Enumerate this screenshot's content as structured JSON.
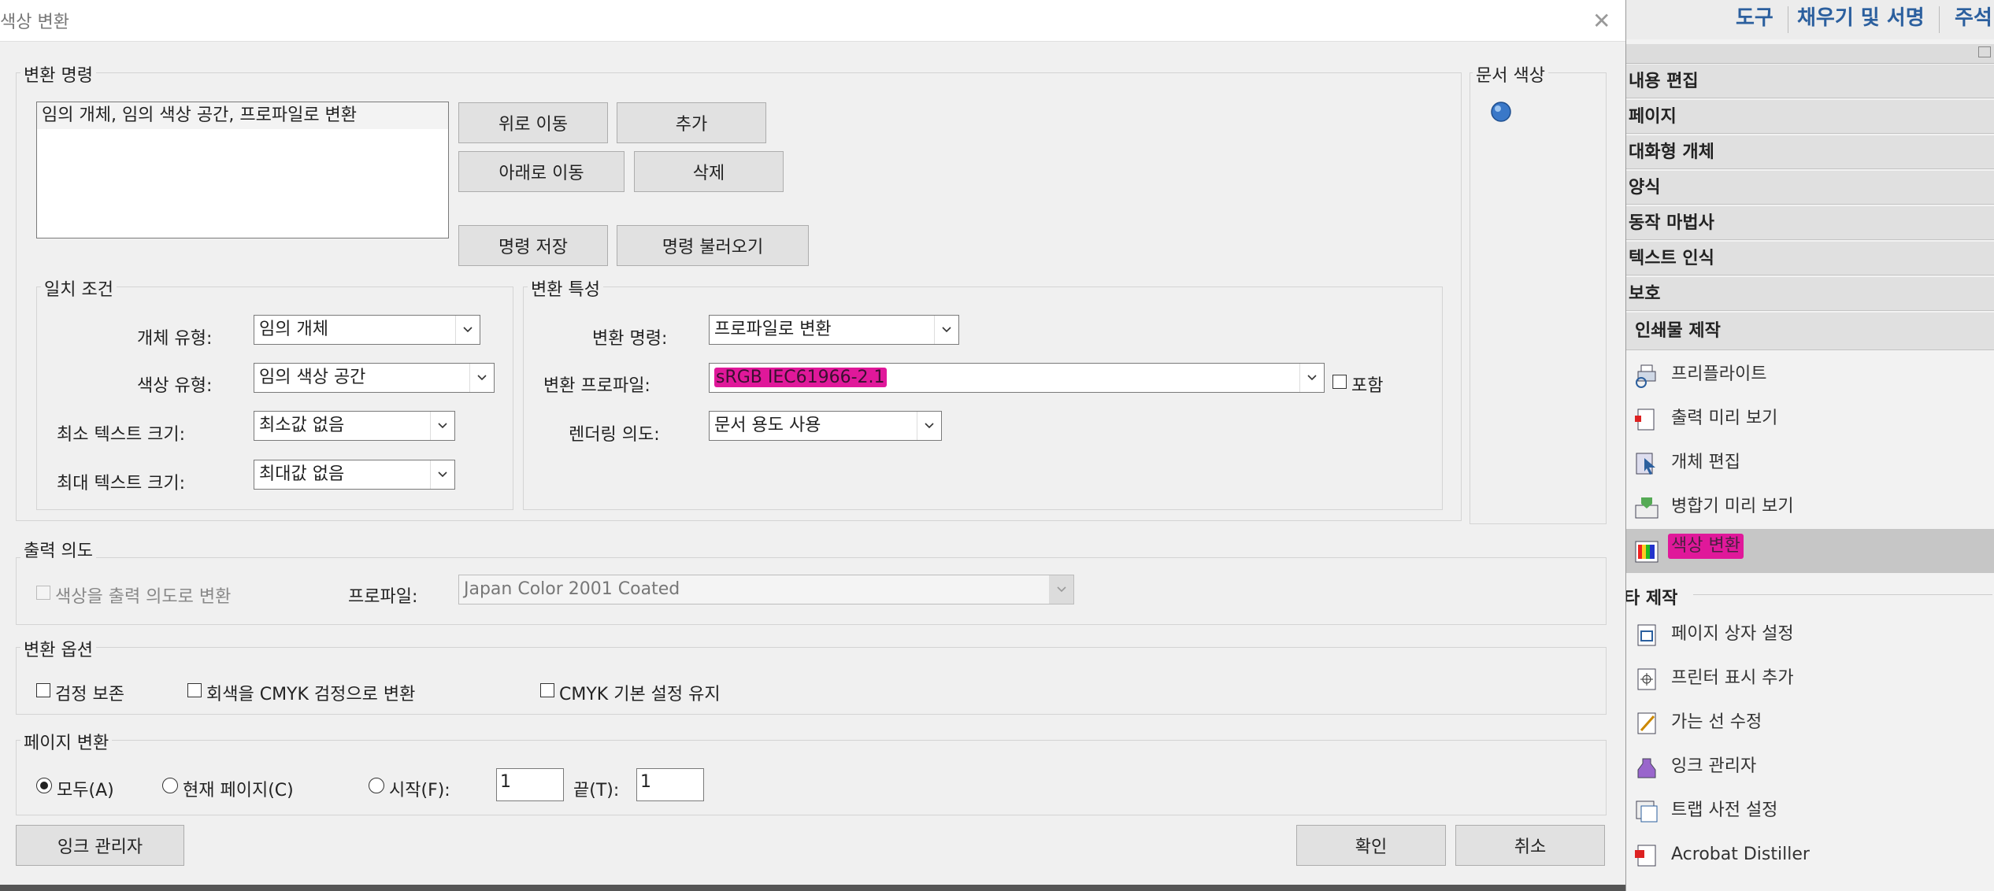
{
  "dialog": {
    "title": "색상 변환",
    "close_glyph": "✕",
    "conversion_commands": {
      "group_title": "변환 명령",
      "list_items": [
        "임의 개체, 임의 색상 공간, 프로파일로 변환"
      ],
      "move_up": "위로 이동",
      "add": "추가",
      "move_down": "아래로 이동",
      "delete": "삭제",
      "save_commands": "명령 저장",
      "load_commands": "명령 불러오기"
    },
    "document_colors": {
      "group_title": "문서 색상"
    },
    "match_criteria": {
      "group_title": "일치 조건",
      "object_type_label": "개체 유형:",
      "object_type_value": "임의 개체",
      "color_type_label": "색상 유형:",
      "color_type_value": "임의 색상 공간",
      "min_text_label": "최소 텍스트 크기:",
      "min_text_value": "최소값 없음",
      "max_text_label": "최대 텍스트 크기:",
      "max_text_value": "최대값 없음"
    },
    "conversion_attributes": {
      "group_title": "변환 특성",
      "command_label": "변환 명령:",
      "command_value": "프로파일로 변환",
      "profile_label": "변환 프로파일:",
      "profile_value": "sRGB IEC61966-2.1",
      "embed_label": "포함",
      "intent_label": "렌더링 의도:",
      "intent_value": "문서 용도 사용"
    },
    "output_intent": {
      "group_title": "출력 의도",
      "convert_checkbox": "색상을 출력 의도로 변환",
      "profile_label": "프로파일:",
      "profile_value": "Japan Color 2001 Coated"
    },
    "conversion_options": {
      "group_title": "변환 옵션",
      "preserve_black": "검정 보존",
      "gray_to_cmyk": "회색을 CMYK 검정으로 변환",
      "keep_cmyk": "CMYK 기본 설정 유지"
    },
    "page_conversion": {
      "group_title": "페이지 변환",
      "all": "모두(A)",
      "current": "현재 페이지(C)",
      "from": "시작(F):",
      "from_value": "1",
      "to": "끝(T):",
      "to_value": "1"
    },
    "ink_manager": "잉크 관리자",
    "ok": "확인",
    "cancel": "취소"
  },
  "tools_pane": {
    "top_tabs": [
      "도구",
      "채우기 및 서명",
      "주석"
    ],
    "sections": [
      "내용 편집",
      "페이지",
      "대화형 개체",
      "양식",
      "동작 마법사",
      "텍스트 인식",
      "보호",
      "인쇄물 제작"
    ],
    "print_production_items": [
      "프리플라이트",
      "출력 미리 보기",
      "개체 편집",
      "병합기 미리 보기",
      "색상 변환"
    ],
    "other_header": "타 제작",
    "other_items": [
      "페이지 상자 설정",
      "프린터 표시 추가",
      "가는 선 수정",
      "잉크 관리자",
      "트랩 사전 설정",
      "Acrobat Distiller"
    ]
  },
  "colors": {
    "accent_blue": "#2b5f9e",
    "highlight_magenta": "#e0189a"
  }
}
